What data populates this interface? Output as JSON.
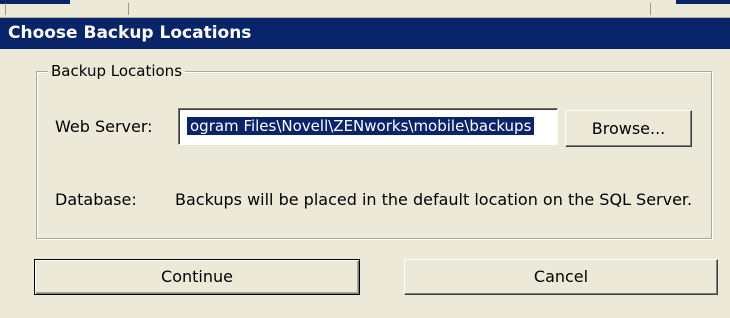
{
  "window": {
    "title": "Choose Backup Locations"
  },
  "group": {
    "legend": "Backup Locations"
  },
  "web_server": {
    "label": "Web Server:",
    "path_value": "ogram Files\\Novell\\ZENworks\\mobile\\backups",
    "browse_label": "Browse..."
  },
  "database": {
    "label": "Database:",
    "message": "Backups will be placed in the default location on the SQL Server."
  },
  "actions": {
    "continue_label": "Continue",
    "cancel_label": "Cancel"
  },
  "colors": {
    "titlebar": "#0a246a",
    "dialog_face": "#ece9d8",
    "selection": "#0a246a"
  }
}
